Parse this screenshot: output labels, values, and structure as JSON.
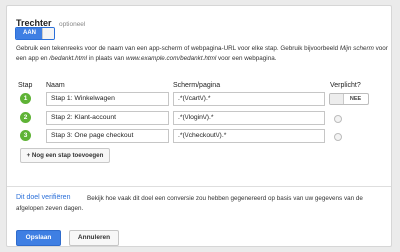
{
  "funnel": {
    "title": "Trechter",
    "optional_label": "optioneel",
    "toggle_on_label": "AAN",
    "description_parts": [
      "Gebruik een tekenreeks voor de naam van een app-scherm of webpagina-URL voor elke stap. Gebruik bijvoorbeeld ",
      "Mijn scherm",
      " voor een app en ",
      "/bedankt.html",
      " in plaats van ",
      "www.example.com/bedankt.html",
      " voor een webpagina."
    ]
  },
  "table": {
    "headers": {
      "step": "Stap",
      "name": "Naam",
      "screen": "Scherm/pagina",
      "required": "Verplicht?"
    },
    "rows": [
      {
        "number": "1",
        "name": "Stap 1: Winkelwagen",
        "screen": ".*(\\/cart\\/).*"
      },
      {
        "number": "2",
        "name": "Stap 2: Klant-account",
        "screen": ".*(\\/login\\/).*"
      },
      {
        "number": "3",
        "name": "Stap 3: One page checkout",
        "screen": ".*(\\/checkout\\/).*"
      }
    ],
    "required_toggle_label": "NEE",
    "add_step_label": "+ Nog een stap toevoegen"
  },
  "verify": {
    "link_label": "Dit doel verifiëren",
    "description": "Bekijk hoe vaak dit doel een conversie zou hebben gegenereerd op basis van uw gegevens van de afgelopen zeven dagen."
  },
  "actions": {
    "save_label": "Opslaan",
    "cancel_label": "Annuleren"
  },
  "colors": {
    "accent": "#3f7fe3",
    "step_badge": "#5fb336",
    "link": "#2a6fd9"
  }
}
